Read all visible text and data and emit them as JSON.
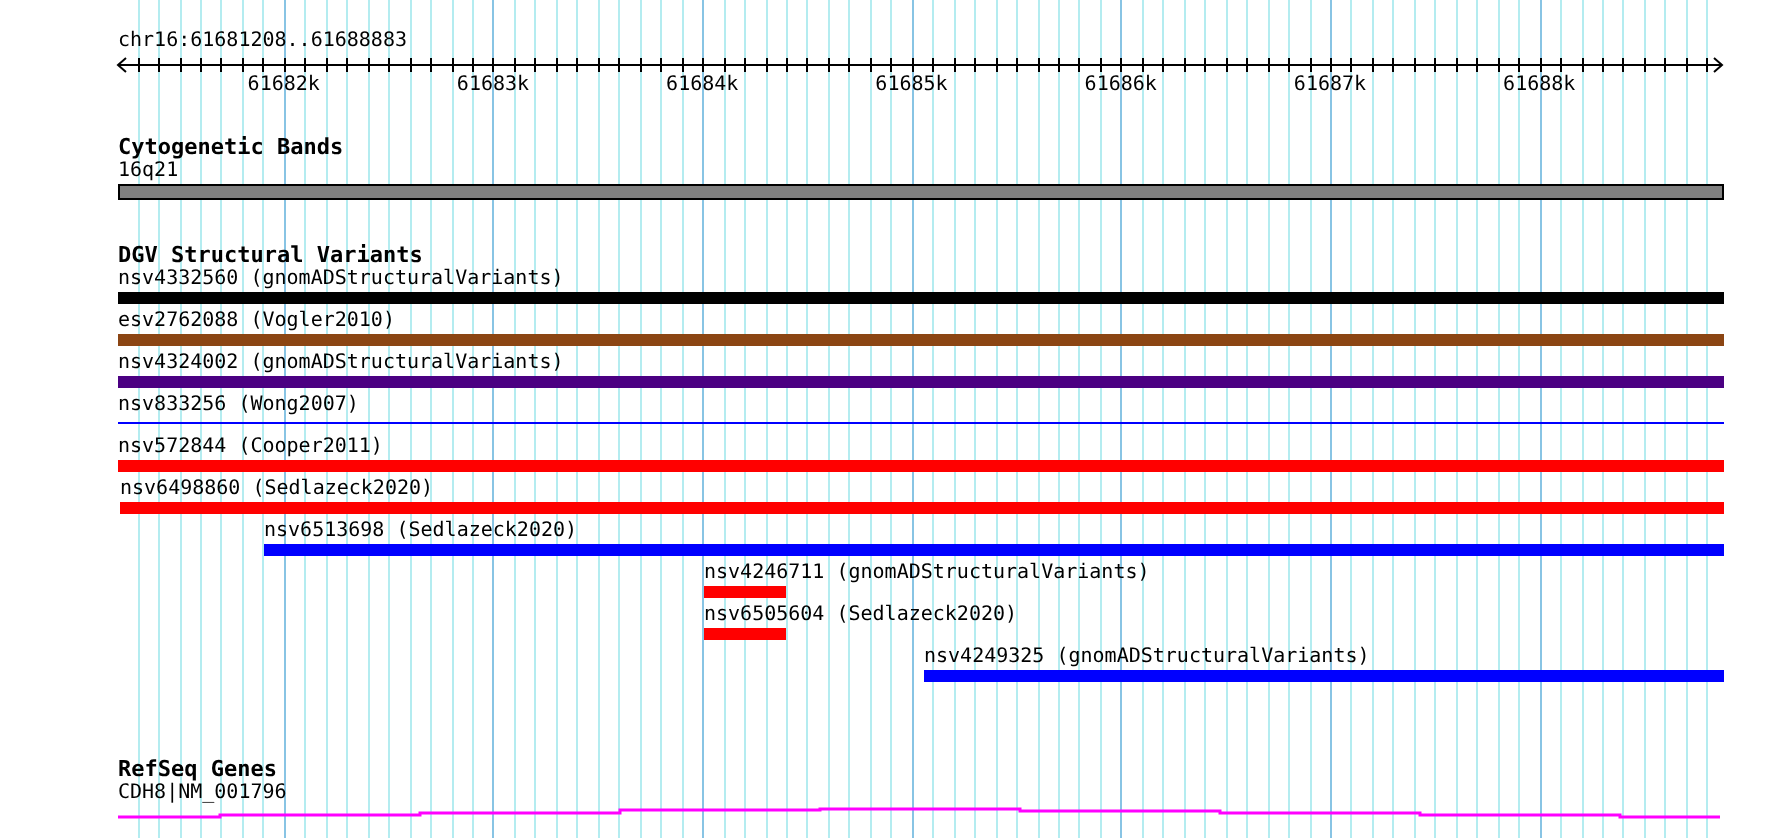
{
  "ruler": {
    "location": "chr16:61681208..61688883",
    "tick_labels": [
      "61682k",
      "61683k",
      "61684k",
      "61685k",
      "61686k",
      "61687k",
      "61688k"
    ]
  },
  "tracks": [
    {
      "title": "Cytogenetic Bands",
      "kind": "bands",
      "features": [
        {
          "label": "16q21",
          "kind": "band",
          "color": "#808080"
        }
      ]
    },
    {
      "title": "DGV Structural Variants",
      "kind": "variants",
      "features": [
        {
          "label": "nsv4332560 (gnomADStructuralVariants)",
          "kind": "bar",
          "color": "#000000"
        },
        {
          "label": "esv2762088 (Vogler2010)",
          "kind": "bar",
          "color": "#8b4513"
        },
        {
          "label": "nsv4324002 (gnomADStructuralVariants)",
          "kind": "bar",
          "color": "#4b0082"
        },
        {
          "label": "nsv833256 (Wong2007)",
          "kind": "line",
          "color": "#0000ff"
        },
        {
          "label": "nsv572844 (Cooper2011)",
          "kind": "bar",
          "color": "#ff0000"
        },
        {
          "label": "nsv6498860 (Sedlazeck2020)",
          "kind": "bar",
          "color": "#ff0000"
        },
        {
          "label": "nsv6513698 (Sedlazeck2020)",
          "kind": "bar",
          "color": "#0000ff"
        },
        {
          "label": "nsv4246711 (gnomADStructuralVariants)",
          "kind": "bar",
          "color": "#ff0000"
        },
        {
          "label": "nsv6505604 (Sedlazeck2020)",
          "kind": "bar",
          "color": "#ff0000"
        },
        {
          "label": "nsv4249325 (gnomADStructuralVariants)",
          "kind": "bar",
          "color": "#0000ff"
        }
      ]
    },
    {
      "title": "RefSeq Genes",
      "kind": "genes",
      "features": [
        {
          "label": "CDH8|NM_001796",
          "kind": "gene",
          "color": "#ff00ff"
        }
      ]
    }
  ]
}
